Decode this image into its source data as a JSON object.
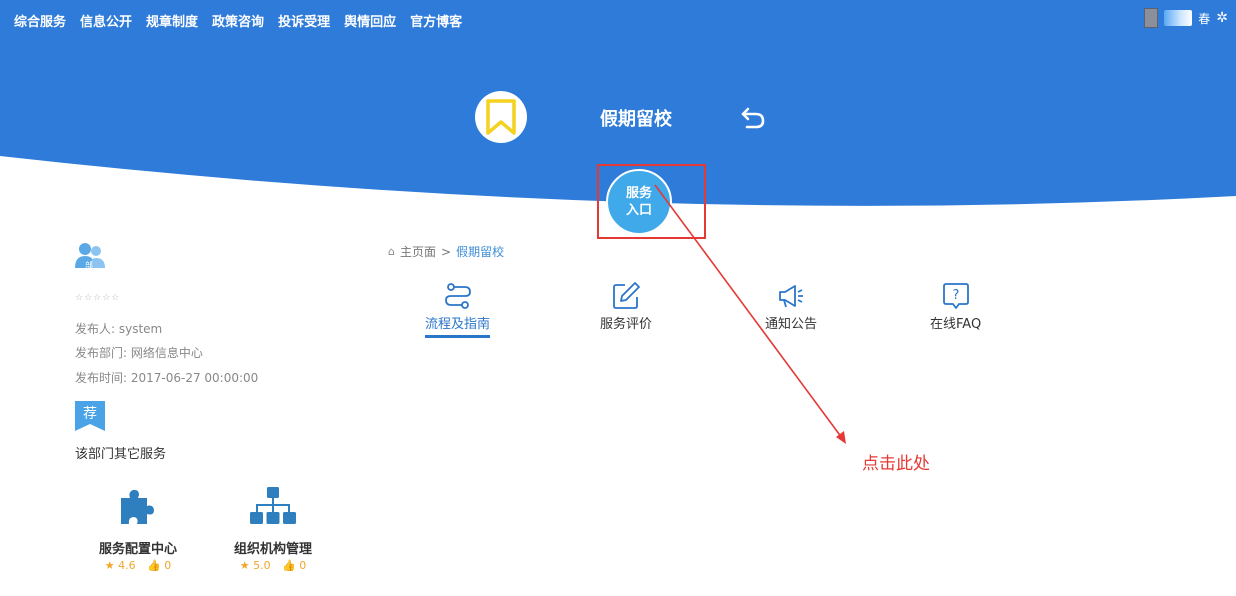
{
  "topnav": {
    "items": [
      "综合服务",
      "信息公开",
      "规章制度",
      "政策咨询",
      "投诉受理",
      "舆情回应",
      "官方博客"
    ]
  },
  "user": {
    "name_tail": "春"
  },
  "header": {
    "title": "假期留校",
    "service_entry": {
      "line1": "服务",
      "line2": "入口"
    }
  },
  "breadcrumb": {
    "home": "主页面",
    "separator": ">",
    "current": "假期留校"
  },
  "tabs": [
    {
      "label": "流程及指南",
      "icon": "flow-icon",
      "active": true
    },
    {
      "label": "服务评价",
      "icon": "edit-icon",
      "active": false
    },
    {
      "label": "通知公告",
      "icon": "megaphone-icon",
      "active": false
    },
    {
      "label": "在线FAQ",
      "icon": "faq-icon",
      "active": false
    }
  ],
  "info": {
    "rating": "☆☆☆☆☆",
    "publisher": "发布人: system",
    "department": "发布部门: 网络信息中心",
    "time": "发布时间: 2017-06-27 00:00:00",
    "recommend_badge": "荐",
    "dept_icon_label": "部",
    "other_services_title": "该部门其它服务"
  },
  "other_services": [
    {
      "name": "服务配置中心",
      "rating": "4.6",
      "likes": "0",
      "icon": "puzzle-icon"
    },
    {
      "name": "组织机构管理",
      "rating": "5.0",
      "likes": "0",
      "icon": "org-chart-icon"
    }
  ],
  "annotation": {
    "text": "点击此处"
  },
  "colors": {
    "primary": "#2e7bd9",
    "accent": "#2a76c9",
    "entry": "#3fa9e9",
    "annotation": "#e53935",
    "star": "#f0a62a"
  }
}
